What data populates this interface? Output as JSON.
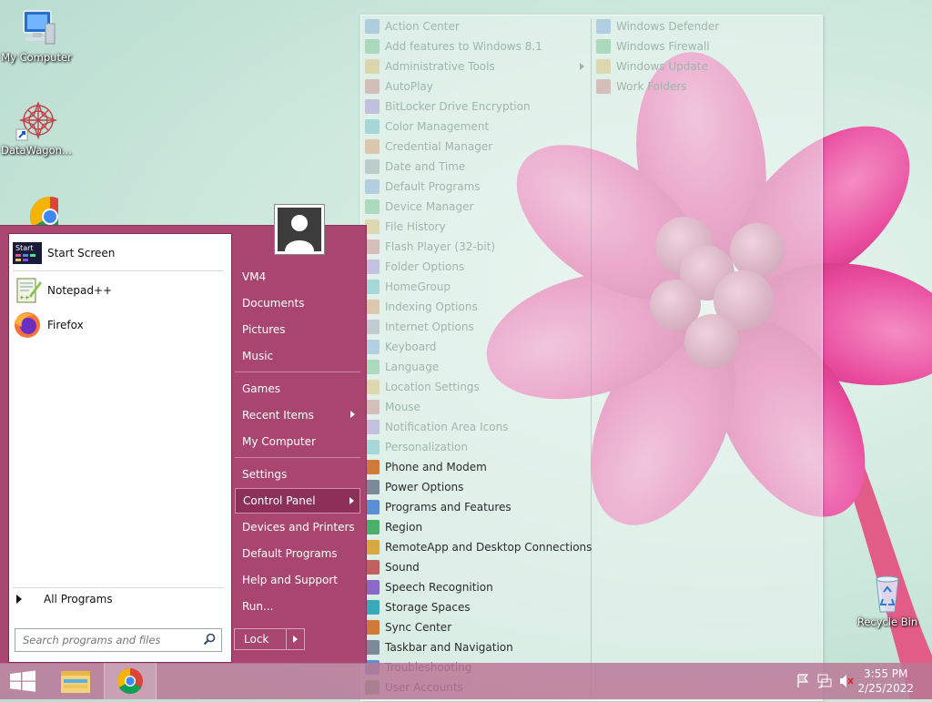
{
  "desktop": {
    "icons": [
      {
        "label": "My Computer"
      },
      {
        "label": "DataWagon..."
      },
      {
        "label": "Recycle Bin"
      }
    ]
  },
  "start_menu": {
    "pinned": [
      {
        "label": "Start Screen",
        "icon": "start-screen-icon"
      },
      {
        "label": "Notepad++",
        "icon": "notepadpp-icon"
      },
      {
        "label": "Firefox",
        "icon": "firefox-icon"
      }
    ],
    "all_programs": "All Programs",
    "search_placeholder": "Search programs and files",
    "right_links": [
      {
        "label": "VM4"
      },
      {
        "label": "Documents"
      },
      {
        "label": "Pictures"
      },
      {
        "label": "Music"
      },
      {
        "label": "Games"
      },
      {
        "label": "Recent Items"
      },
      {
        "label": "My Computer"
      },
      {
        "label": "Settings"
      },
      {
        "label": "Control Panel"
      },
      {
        "label": "Devices and Printers"
      },
      {
        "label": "Default Programs"
      },
      {
        "label": "Help and Support"
      },
      {
        "label": "Run..."
      }
    ],
    "lock_label": "Lock"
  },
  "control_panel": {
    "column1": [
      "Action Center",
      "Add features to Windows 8.1",
      "Administrative Tools",
      "AutoPlay",
      "BitLocker Drive Encryption",
      "Color Management",
      "Credential Manager",
      "Date and Time",
      "Default Programs",
      "Device Manager",
      "File History",
      "Flash Player (32-bit)",
      "Folder Options",
      "HomeGroup",
      "Indexing Options",
      "Internet Options",
      "Keyboard",
      "Language",
      "Location Settings",
      "Mouse",
      "Notification Area Icons",
      "Personalization",
      "Phone and Modem",
      "Power Options",
      "Programs and Features",
      "Region",
      "RemoteApp and Desktop Connections",
      "Sound",
      "Speech Recognition",
      "Storage Spaces",
      "Sync Center",
      "Taskbar and Navigation",
      "Troubleshooting",
      "User Accounts"
    ],
    "column2": [
      "Windows Defender",
      "Windows Firewall",
      "Windows Update",
      "Work Folders"
    ]
  },
  "taskbar": {
    "time": "3:55 PM",
    "date": "2/25/2022"
  },
  "colors": {
    "start_menu_bg": "#a8466f",
    "active_item_bg": "#8c2f59",
    "taskbar": "#ba7896"
  }
}
